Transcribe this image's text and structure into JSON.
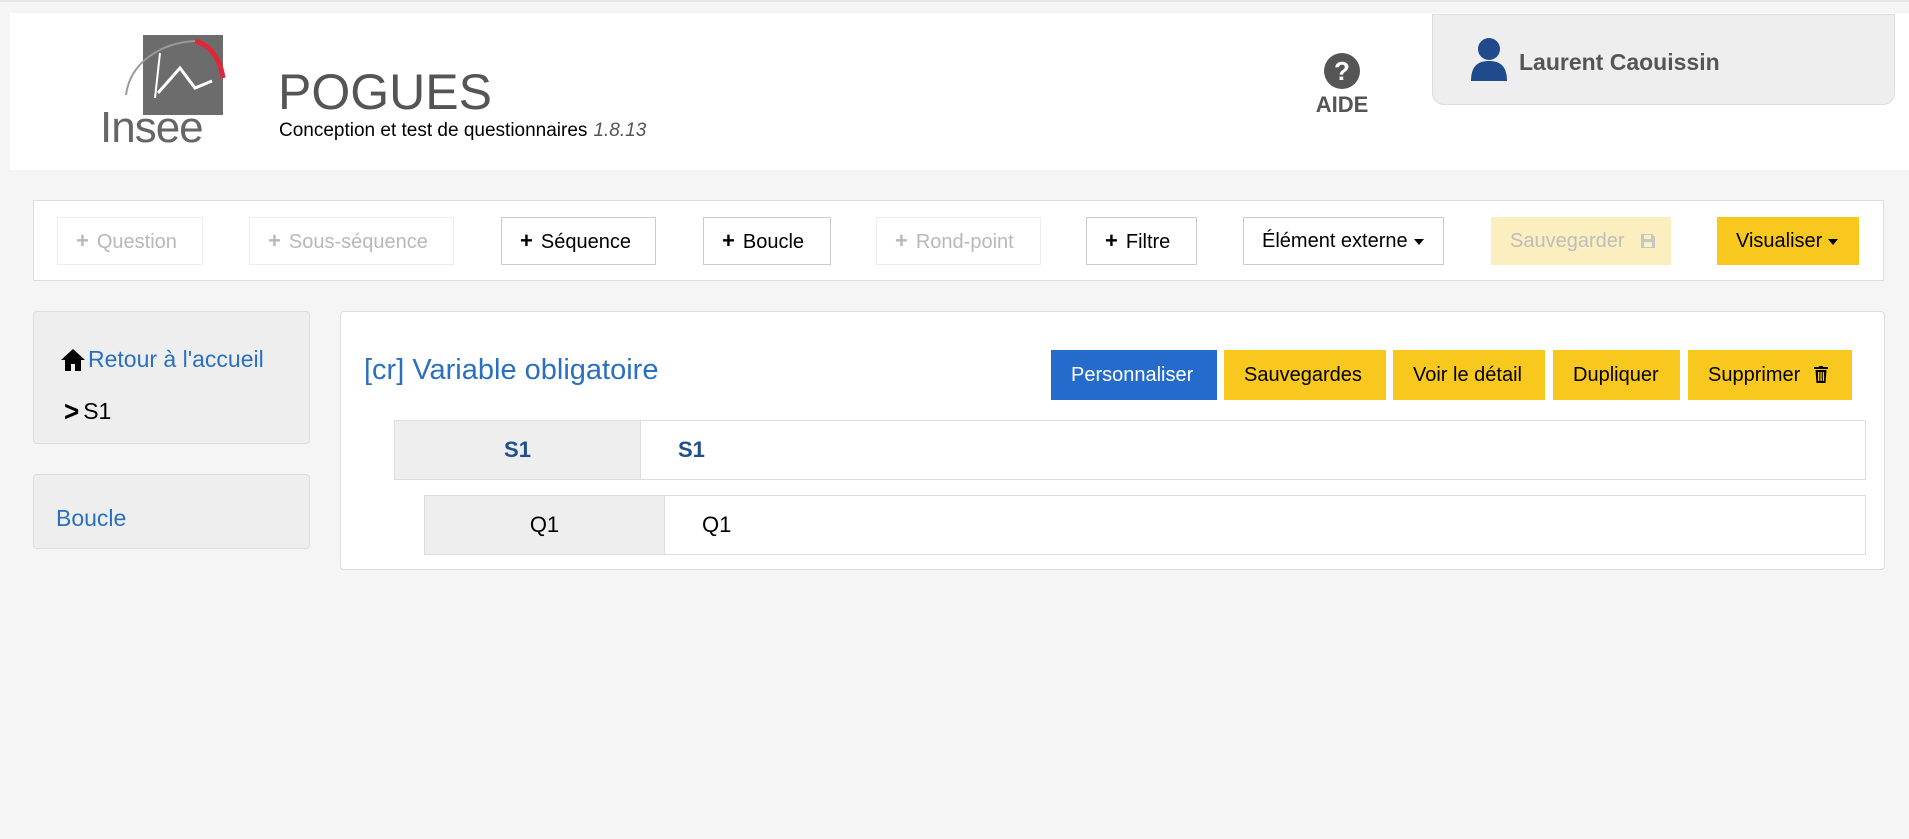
{
  "header": {
    "logo_text": "Insee",
    "app_title": "POGUES",
    "app_subtitle": "Conception et test de questionnaires",
    "app_version": "1.8.13",
    "help_label": "AIDE",
    "user_name": "Laurent Caouissin"
  },
  "toolbar": {
    "question": "Question",
    "sub_sequence": "Sous-séquence",
    "sequence": "Séquence",
    "loop": "Boucle",
    "roundabout": "Rond-point",
    "filter": "Filtre",
    "external": "Élément externe",
    "save": "Sauvegarder",
    "visualize": "Visualiser"
  },
  "sidebar": {
    "home": "Retour à l'accueil",
    "current": "S1",
    "loop": "Boucle"
  },
  "main": {
    "title": "[cr] Variable obligatoire",
    "actions": {
      "customize": "Personnaliser",
      "backups": "Sauvegardes",
      "details": "Voir le détail",
      "duplicate": "Dupliquer",
      "delete": "Supprimer"
    },
    "rows": [
      {
        "label": "S1",
        "value": "S1"
      },
      {
        "label": "Q1",
        "value": "Q1"
      }
    ]
  },
  "colors": {
    "accent_yellow": "#f8c81e",
    "primary_blue": "#246bcb",
    "link_blue": "#2a6fc0",
    "logo_red": "#e0263a"
  }
}
